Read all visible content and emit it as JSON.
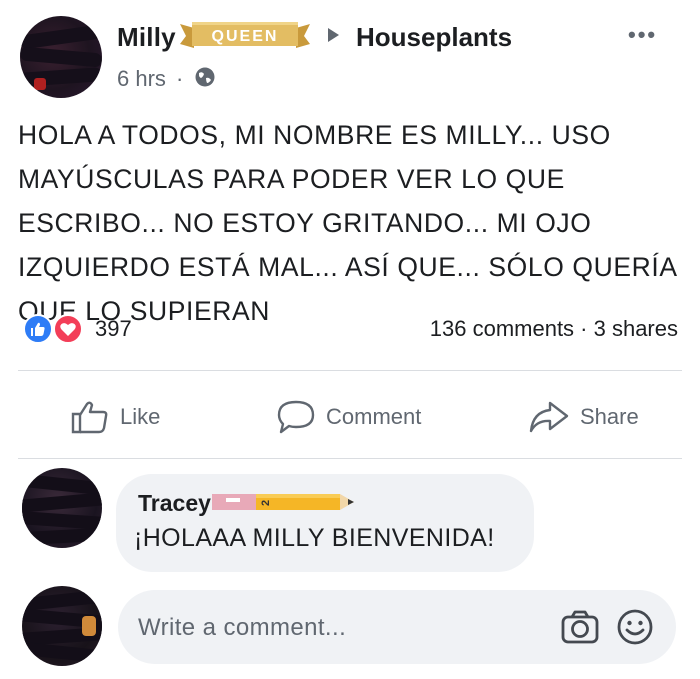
{
  "post": {
    "author": "Milly",
    "badge_text": "QUEEN",
    "group": "Houseplants",
    "time": "6 hrs",
    "separator": "·",
    "more": "•••",
    "body": "HOLA A TODOS, MI NOMBRE ES MILLY... USO MAYÚSCULAS PARA PODER VER LO QUE ESCRIBO... NO ESTOY GRITANDO... MI OJO IZQUIERDO ESTÁ MAL... ASÍ QUE... SÓLO QUERÍA QUE LO SUPIERAN",
    "reaction_count": "397",
    "comments_shares": "136 comments · 3 shares"
  },
  "actions": {
    "like": "Like",
    "comment": "Comment",
    "share": "Share"
  },
  "comment": {
    "name": "Tracey",
    "sticker_number": "2",
    "text": "¡HOLAAA MILLY BIENVENIDA!"
  },
  "composer": {
    "placeholder": "Write a comment..."
  },
  "colors": {
    "like_blue": "#2e7cf6",
    "love_red": "#f33e58",
    "text_gray": "#606770",
    "bubble_bg": "#f0f2f5",
    "badge_gold": "#d4a94a"
  }
}
